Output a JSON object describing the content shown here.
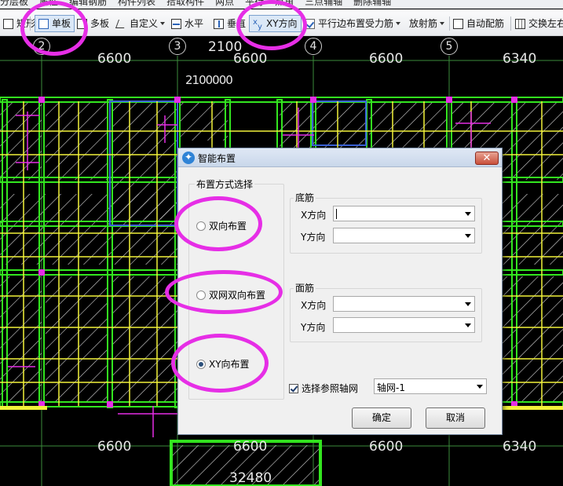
{
  "top_menu": [
    "分层板",
    "属性",
    "编辑钢筋",
    "构件列表",
    "拾取构件",
    "两点",
    "平行",
    "点角",
    "三点辅轴",
    "删除辅轴"
  ],
  "toolbar": {
    "left_clip": "矩形",
    "single_board": "单板",
    "multi_board": "多板",
    "custom": "自定义",
    "horizontal": "水平",
    "vertical": "垂直",
    "xy_direction": "XY方向",
    "parallel_edge": "平行边布置受力筋",
    "radial": "放射筋",
    "auto_rebar": "自动配筋",
    "swap": "交换左右"
  },
  "cad": {
    "axes": [
      "2",
      "3",
      "4",
      "5"
    ],
    "dims_top": [
      "6600",
      "2100",
      "6600",
      "6600",
      "6340"
    ],
    "dim_overlap": "2100000",
    "dims_bottom": [
      "6600",
      "6600",
      "6600",
      "6340"
    ],
    "dim_total": "32480"
  },
  "dialog": {
    "title": "智能布置",
    "close": "✕",
    "mode_group": "布置方式选择",
    "modes": [
      "双向布置",
      "双网双向布置",
      "XY向布置"
    ],
    "selected_mode": "XY向布置",
    "bottom_group": "底筋",
    "top_group": "面筋",
    "x_label": "X方向",
    "y_label": "Y方向",
    "bottom_x": "",
    "bottom_y": "",
    "top_x": "",
    "top_y": "",
    "ref_axis_label": "选择参照轴网",
    "ref_axis_checked": true,
    "ref_axis_value": "轴网-1",
    "ok": "确定",
    "cancel": "取消"
  },
  "colors": {
    "highlight": "#e62ee6",
    "beam_green": "#33e61f",
    "rebar_yellow": "#f2f23a",
    "accent_blue": "#2f83d6"
  }
}
